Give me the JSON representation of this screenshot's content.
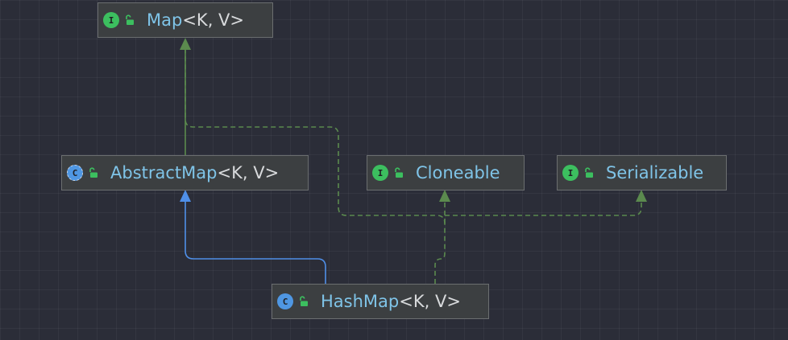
{
  "diagram": {
    "nodes": [
      {
        "id": "map",
        "kind": "interface",
        "icon_letter": "I",
        "name": "Map",
        "generics": "<K, V>"
      },
      {
        "id": "abstractmap",
        "kind": "abstract-class",
        "icon_letter": "C",
        "name": "AbstractMap",
        "generics": "<K, V>"
      },
      {
        "id": "cloneable",
        "kind": "interface",
        "icon_letter": "I",
        "name": "Cloneable",
        "generics": ""
      },
      {
        "id": "serializable",
        "kind": "interface",
        "icon_letter": "I",
        "name": "Serializable",
        "generics": ""
      },
      {
        "id": "hashmap",
        "kind": "class",
        "icon_letter": "C",
        "name": "HashMap",
        "generics": "<K, V>"
      }
    ],
    "edges": [
      {
        "from": "abstractmap",
        "to": "map",
        "relation": "implements",
        "style": "solid-green"
      },
      {
        "from": "hashmap",
        "to": "map",
        "relation": "implements",
        "style": "dashed-green"
      },
      {
        "from": "hashmap",
        "to": "cloneable",
        "relation": "implements",
        "style": "dashed-green"
      },
      {
        "from": "hashmap",
        "to": "serializable",
        "relation": "implements",
        "style": "dashed-green"
      },
      {
        "from": "hashmap",
        "to": "abstractmap",
        "relation": "extends",
        "style": "solid-blue"
      }
    ]
  },
  "colors": {
    "background": "#2b2d38",
    "node_bg": "#3c3f41",
    "node_border": "#6b6e70",
    "type_name": "#7fc4e8",
    "generics": "#d8dadc",
    "implements_line": "#5b8a4e",
    "extends_line": "#4f8fe8",
    "interface_icon": "#3cbf5f",
    "class_icon": "#4f97e3",
    "lock_icon": "#3cbf5f"
  }
}
